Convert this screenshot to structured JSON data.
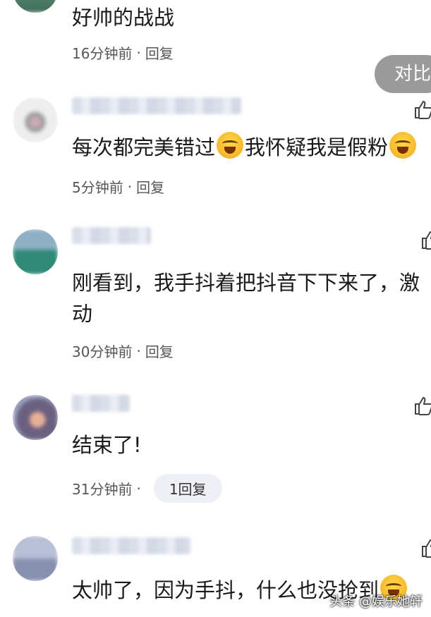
{
  "compare_button": "对比",
  "comments": [
    {
      "text": "好帅的战战",
      "time": "16分钟前",
      "reply": "回复"
    },
    {
      "text_a": "每次都完美错过",
      "text_b": "我怀疑我是假粉",
      "time": "5分钟前",
      "reply": "回复",
      "emoji": "crying-laughing-emoji"
    },
    {
      "line1": "刚看到，我手抖着把抖音下下来了，激",
      "line2": "动",
      "time": "30分钟前",
      "reply": "回复"
    },
    {
      "text": "结束了!",
      "time": "31分钟前",
      "reply_count": "1回复"
    },
    {
      "text": "太帅了，因为手抖，什么也没抢到",
      "emoji": "crying-laughing-emoji"
    }
  ],
  "watermark": "头条 @娱乐她轩",
  "colors": {
    "background": "#ffffff",
    "meta": "#555555",
    "pill": "#eef0f5",
    "compare": "#9a9a9a"
  }
}
